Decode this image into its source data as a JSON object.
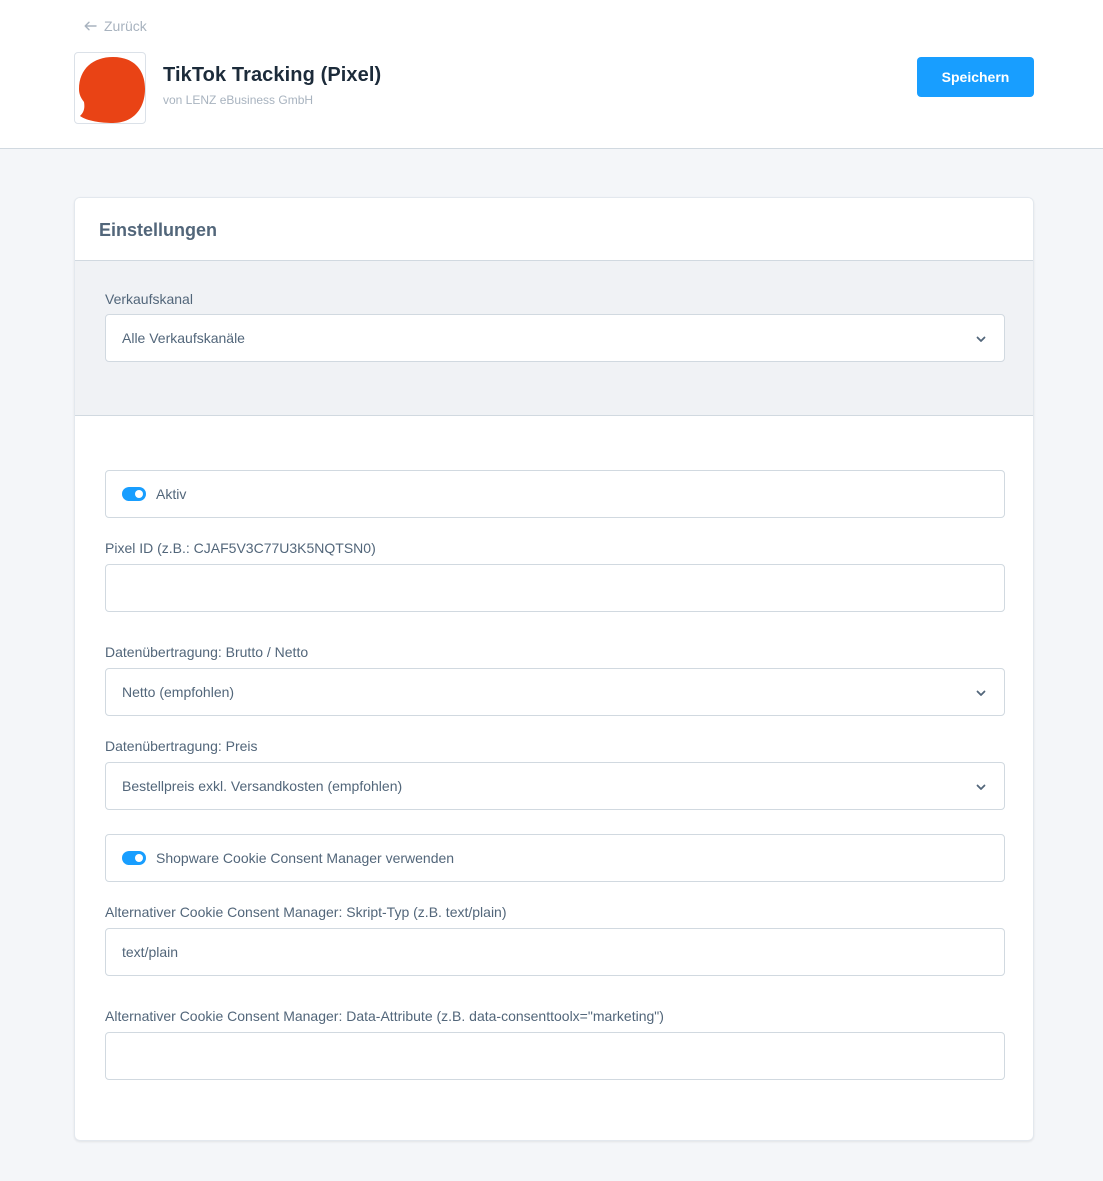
{
  "header": {
    "back_label": "Zurück",
    "title": "TikTok Tracking (Pixel)",
    "vendor": "von LENZ eBusiness GmbH",
    "save_label": "Speichern",
    "logo_icon": "orange-speech-bubble-logo",
    "accent_color": "#189eff",
    "logo_color": "#e94315"
  },
  "card": {
    "title": "Einstellungen",
    "channel": {
      "label": "Verkaufskanal",
      "value": "Alle Verkaufskanäle"
    },
    "fields": {
      "active_label": "Aktiv",
      "pixel_id_label": "Pixel ID (z.B.: CJAF5V3C77U3K5NQTSN0)",
      "pixel_id_value": "",
      "gross_net_label": "Datenübertragung: Brutto / Netto",
      "gross_net_value": "Netto (empfohlen)",
      "price_label": "Datenübertragung: Preis",
      "price_value": "Bestellpreis exkl. Versandkosten (empfohlen)",
      "cookie_manager_label": "Shopware Cookie Consent Manager verwenden",
      "script_type_label": "Alternativer Cookie Consent Manager: Skript-Typ (z.B. text/plain)",
      "script_type_value": "text/plain",
      "data_attr_label": "Alternativer Cookie Consent Manager: Data-Attribute (z.B. data-consenttoolx=\"marketing\")",
      "data_attr_value": ""
    }
  }
}
